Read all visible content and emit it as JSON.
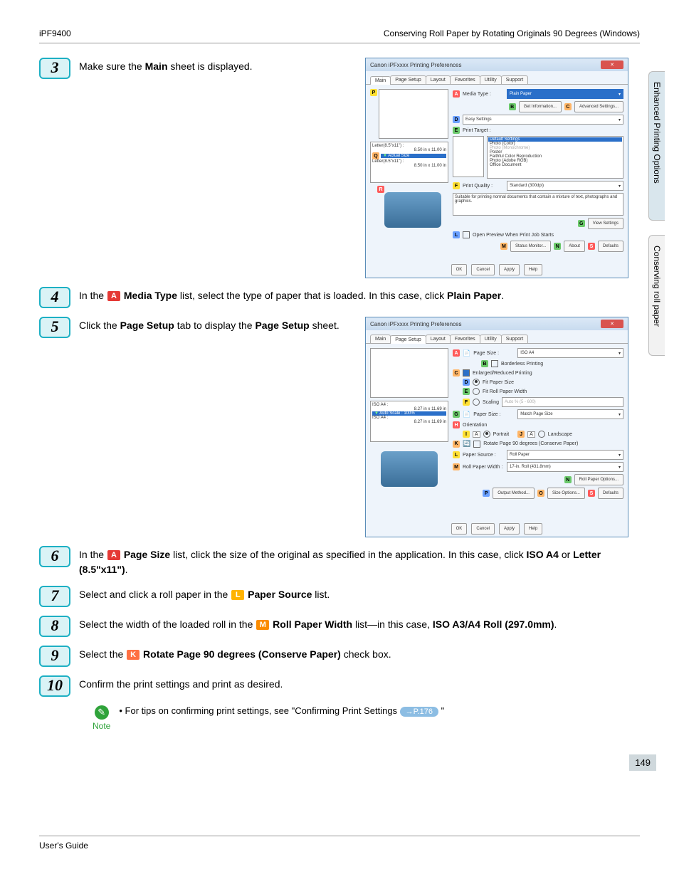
{
  "header": {
    "left": "iPF9400",
    "right": "Conserving Roll Paper by Rotating Originals 90 Degrees (Windows)"
  },
  "side_tabs": {
    "top": "Enhanced Printing Options",
    "bottom": "Conserving roll paper"
  },
  "steps": {
    "s3": {
      "num": "3",
      "t1": "Make sure the ",
      "b1": "Main",
      "t2": " sheet is displayed."
    },
    "s4": {
      "num": "4",
      "t1": "In the ",
      "lbl": "A",
      "b1": "Media Type",
      "t2": " list, select the type of paper that is loaded. In this case, click ",
      "b2": "Plain Paper",
      "t3": "."
    },
    "s5": {
      "num": "5",
      "t1": "Click the ",
      "b1": "Page Setup",
      "t2": " tab to display the ",
      "b2": "Page Setup",
      "t3": " sheet."
    },
    "s6": {
      "num": "6",
      "t1": "In the ",
      "lbl": "A",
      "b1": "Page Size",
      "t2": " list, click the size of the original as specified in the application. In this case, click ",
      "b2": "ISO A4",
      "t3": " or ",
      "b3": "Letter (8.5\"x11\")",
      "t4": "."
    },
    "s7": {
      "num": "7",
      "t1": "Select and click a roll paper in the ",
      "lbl": "L",
      "b1": "Paper Source",
      "t2": " list."
    },
    "s8": {
      "num": "8",
      "t1": "Select the width of the loaded roll in the ",
      "lbl": "M",
      "b1": "Roll Paper Width",
      "t2": " list—in this case, ",
      "b2": "ISO A3/A4 Roll (297.0mm)",
      "t3": "."
    },
    "s9": {
      "num": "9",
      "t1": "Select the ",
      "lbl": "K",
      "b1": "Rotate Page 90 degrees (Conserve Paper)",
      "t2": " check box."
    },
    "s10": {
      "num": "10",
      "t1": "Confirm the print settings and print as desired."
    }
  },
  "note": {
    "icon_label": "Note",
    "bullet": "•",
    "t1": "For tips on confirming print settings, see \"Confirming Print Settings ",
    "ref": "→P.176",
    "t2": " \""
  },
  "ss1": {
    "title": "Canon iPFxxxx Printing Preferences",
    "tabs": [
      "Main",
      "Page Setup",
      "Layout",
      "Favorites",
      "Utility",
      "Support"
    ],
    "active_tab": 0,
    "media_type_label": "Media Type :",
    "media_type_value": "Plain Paper",
    "btn_get_info": "Get Information...",
    "btn_adv": "Advanced Settings...",
    "easy_label": "Easy Settings",
    "print_target_label": "Print Target :",
    "targets": [
      "Default Settings",
      "Photo (Color)",
      "Photo (Monochrome)",
      "Poster",
      "Faithful Color Reproduction",
      "Photo (Adobe RGB)",
      "Office Document"
    ],
    "quality_label": "Print Quality :",
    "quality_value": "Standard (300dpi)",
    "desc": "Suitable for printing normal documents that contain a mixture of text, photographs and graphics.",
    "view_settings": "View Settings",
    "open_preview": "Open Preview When Print Job Starts",
    "status_monitor": "Status Monitor...",
    "about": "About",
    "defaults": "Defaults",
    "sizes": {
      "a": "Letter(8.5\"x11\") :",
      "a2": "8.50 in x 11.00 in",
      "mid": "Actual Size",
      "b": "Letter(8.5\"x11\") :",
      "b2": "8.50 in x 11.00 in"
    },
    "footer": [
      "OK",
      "Cancel",
      "Apply",
      "Help"
    ]
  },
  "ss2": {
    "title": "Canon iPFxxxx Printing Preferences",
    "tabs": [
      "Main",
      "Page Setup",
      "Layout",
      "Favorites",
      "Utility",
      "Support"
    ],
    "active_tab": 1,
    "page_size_label": "Page Size :",
    "page_size_value": "ISO A4",
    "borderless": "Borderless Printing",
    "enlarged": "Enlarged/Reduced Printing",
    "fit_paper": "Fit Paper Size",
    "fit_roll": "Fit Roll Paper Width",
    "scaling": "Scaling",
    "scaling_box": "Auto     %  (5 - 600)",
    "paper_size_label": "Paper Size :",
    "paper_size_value": "Match Page Size",
    "orientation": "Orientation",
    "portrait": "Portrait",
    "landscape": "Landscape",
    "rotate": "Rotate Page 90 degrees (Conserve Paper)",
    "paper_source_label": "Paper Source :",
    "paper_source_value": "Roll Paper",
    "roll_width_label": "Roll Paper Width :",
    "roll_width_value": "17-in. Roll (431.8mm)",
    "roll_options": "Roll Paper Options...",
    "output_method": "Output Method...",
    "size_options": "Size Options...",
    "defaults": "Defaults",
    "sizes": {
      "a": "ISO A4 :",
      "a2": "8.27 in x 11.69 in",
      "mid": "Auto Scale : 100%",
      "b": "ISO A4 :",
      "b2": "8.27 in x 11.69 in"
    },
    "footer": [
      "OK",
      "Cancel",
      "Apply",
      "Help"
    ]
  },
  "page_number": "149",
  "footer": {
    "left": "User's Guide"
  },
  "chart_data": {
    "type": "table",
    "note": "No chart present; document page."
  }
}
